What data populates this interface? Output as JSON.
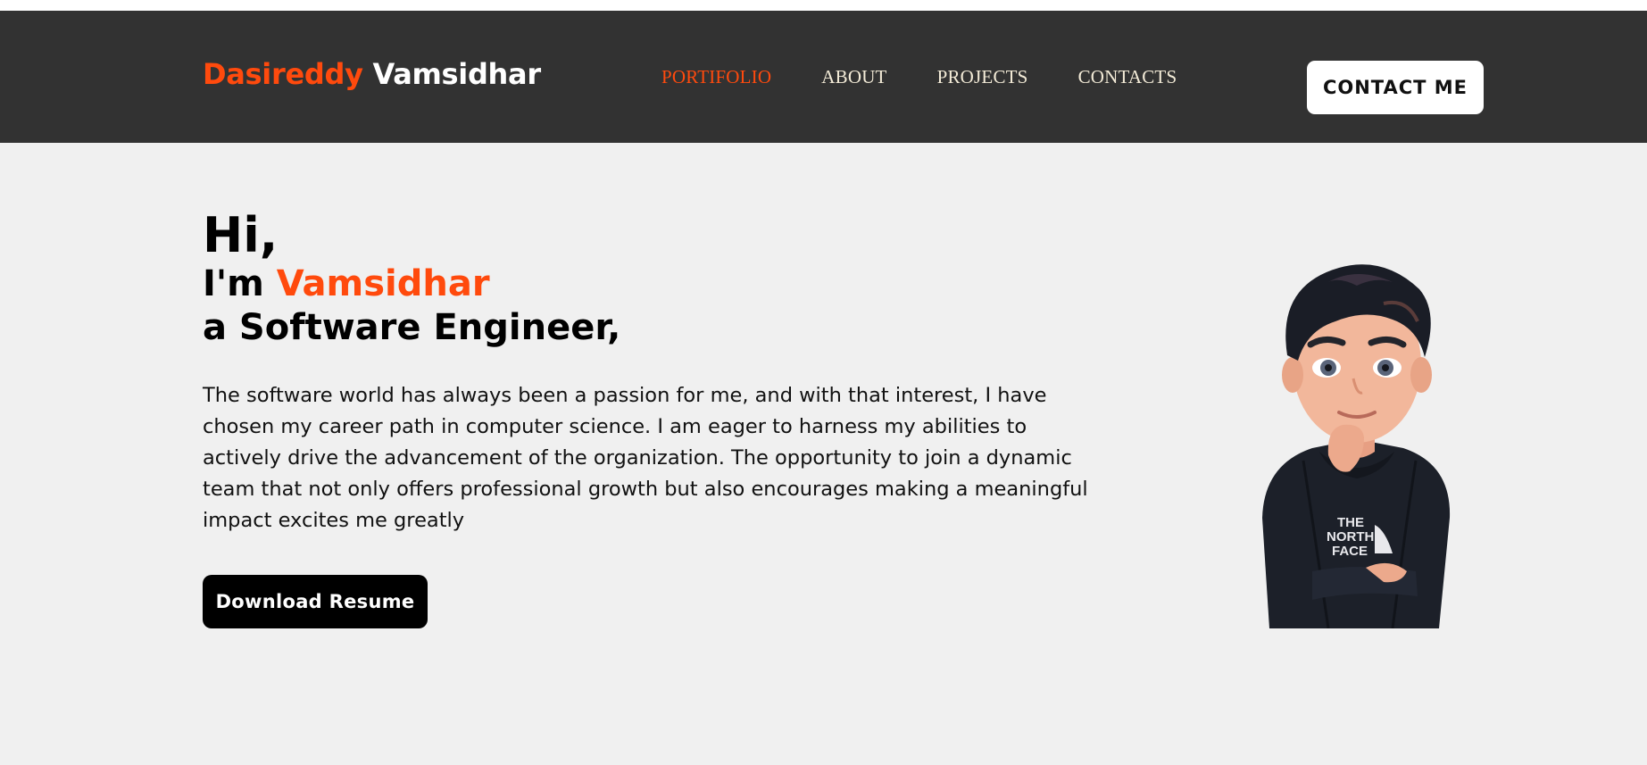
{
  "navbar": {
    "brand_first": "Dasireddy",
    "brand_last": "Vamsidhar",
    "links": [
      {
        "label": "PORTIFOLIO",
        "active": true
      },
      {
        "label": "ABOUT",
        "active": false
      },
      {
        "label": "PROJECTS",
        "active": false
      },
      {
        "label": "CONTACTS",
        "active": false
      }
    ],
    "contact_button": "CONTACT ME"
  },
  "hero": {
    "greeting": "Hi,",
    "intro_prefix": "I'm",
    "intro_name": "Vamsidhar",
    "role": "a Software Engineer,",
    "description": "The software world has always been a passion for me, and with that interest, I have chosen my career path in computer science. I am eager to harness my abilities to actively drive the advancement of the organization. The opportunity to join a dynamic team that not only offers professional growth but also encourages making a meaningful impact excites me greatly",
    "download_button": "Download Resume",
    "avatar_shirt_text": [
      "THE",
      "NORTH",
      "FACE"
    ]
  },
  "colors": {
    "accent": "#ff4a0d",
    "navbar_bg": "#323232",
    "page_bg": "#f0f0f0"
  }
}
